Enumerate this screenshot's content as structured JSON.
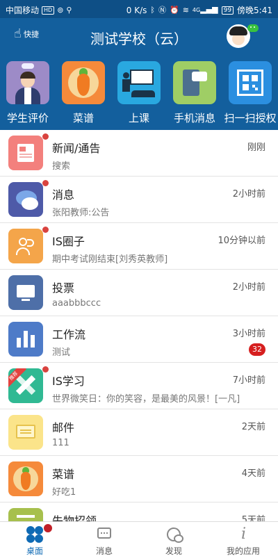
{
  "status_bar": {
    "carrier": "中国移动",
    "hd": "HD",
    "speed": "0 K/s",
    "signal_type": "4G",
    "battery": "99",
    "time": "傍晚5:41"
  },
  "header": {
    "quick_label": "快捷",
    "title": "测试学校（云）"
  },
  "shortcuts": [
    {
      "label": "学生评价",
      "icon": "student-evaluation-icon"
    },
    {
      "label": "菜谱",
      "icon": "carrot-menu-icon"
    },
    {
      "label": "上课",
      "icon": "classroom-icon"
    },
    {
      "label": "手机消息",
      "icon": "phone-message-icon"
    },
    {
      "label": "扫一扫授权",
      "icon": "qr-scan-icon"
    }
  ],
  "list": [
    {
      "title": "新闻/通告",
      "subtitle": "搜索",
      "time": "刚刚",
      "unread": true,
      "icon": "news-icon"
    },
    {
      "title": "消息",
      "subtitle": "张阳教师:公告",
      "time": "2小时前",
      "unread": true,
      "icon": "chat-bubbles-icon"
    },
    {
      "title": "IS圈子",
      "subtitle": "期中考试刚结束[刘秀英教师]",
      "time": "10分钟以前",
      "unread": true,
      "icon": "group-icon"
    },
    {
      "title": "投票",
      "subtitle": "aaabbbccc",
      "time": "2小时前",
      "unread": false,
      "icon": "vote-monitor-icon"
    },
    {
      "title": "工作流",
      "subtitle": "测试",
      "time": "3小时前",
      "unread": false,
      "badge": "32",
      "icon": "bar-chart-icon"
    },
    {
      "title": "IS学习",
      "subtitle": "世界微笑日：你的笑容，是最美的风景！[一凡]",
      "time": "7小时前",
      "unread": true,
      "ribbon": "推荐",
      "icon": "pencil-ruler-icon"
    },
    {
      "title": "邮件",
      "subtitle": "111",
      "time": "2天前",
      "unread": false,
      "icon": "mail-icon"
    },
    {
      "title": "菜谱",
      "subtitle": "好吃1",
      "time": "4天前",
      "unread": false,
      "icon": "carrot-menu-icon"
    },
    {
      "title": "失物招领",
      "subtitle": "",
      "time": "5天前",
      "unread": false,
      "icon": "lost-found-icon"
    }
  ],
  "tabbar": [
    {
      "label": "桌面",
      "active": true,
      "icon": "desktop-clover-icon"
    },
    {
      "label": "消息",
      "active": false,
      "icon": "message-icon"
    },
    {
      "label": "发现",
      "active": false,
      "icon": "discover-icon"
    },
    {
      "label": "我的应用",
      "active": false,
      "icon": "my-apps-icon"
    }
  ],
  "colors": {
    "header": "#135f9d",
    "status_bar": "#0e4f86",
    "unread_dot": "#d9433f",
    "badge": "#d61f1f",
    "tab_active": "#0e6ab4"
  }
}
